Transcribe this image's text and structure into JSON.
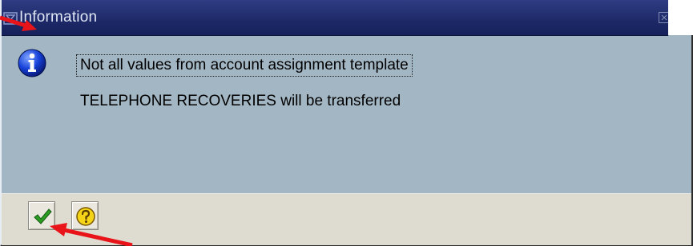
{
  "dialog": {
    "title": "Information",
    "title_icon": "window-menu-icon",
    "close_icon": "close-icon"
  },
  "message": {
    "icon": "info-icon",
    "line1": "Not all values from account assignment template",
    "line2": "TELEPHONE RECOVERIES will be transferred"
  },
  "footer": {
    "buttons": [
      {
        "name": "continue-button",
        "icon": "green-checkmark-icon"
      },
      {
        "name": "help-button",
        "icon": "help-question-icon"
      }
    ]
  },
  "annotations": {
    "arrow_color": "#e8141a"
  }
}
